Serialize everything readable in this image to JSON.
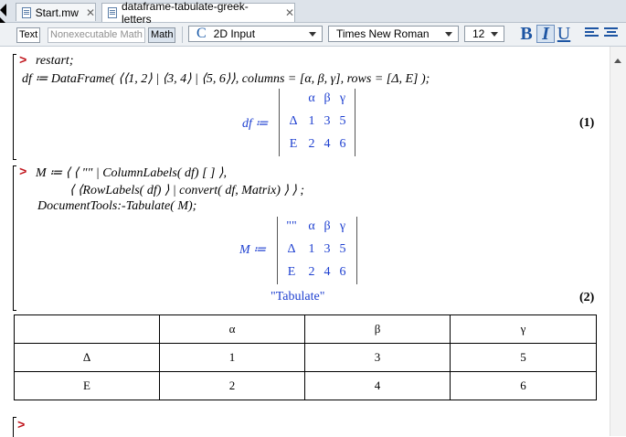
{
  "tabs": [
    {
      "label": "Start.mw",
      "close": "✕"
    },
    {
      "label": "dataframe-tabulate-greek-letters",
      "close": "✕"
    }
  ],
  "toolbar": {
    "mode_text": "Text",
    "mode_nonexec": "Nonexecutable Math",
    "mode_math": "Math",
    "input_mode": "2D Input",
    "font": "Times New Roman",
    "size": "12",
    "bold": "B",
    "italic": "I",
    "underline": "U"
  },
  "doc": {
    "prompt": ">",
    "group1": {
      "line1": "restart;",
      "line2_a": "df",
      "line2_b": " ≔ DataFrame( ⟨⟨1, 2⟩ | ⟨3, 4⟩ | ⟨5, 6⟩⟩, columns = [α, β, γ], rows = [Δ, Ε] );",
      "out_lhs": "df ≔",
      "matrix": {
        "header": [
          "",
          "α",
          "β",
          "γ"
        ],
        "rows": [
          [
            "Δ",
            "1",
            "3",
            "5"
          ],
          [
            "Ε",
            "2",
            "4",
            "6"
          ]
        ]
      },
      "label": "(1)"
    },
    "group2": {
      "line1": "M ≔ ⟨ ⟨ \"\" | ColumnLabels( df) [ ] ⟩,",
      "line2": "⟨ ⟨RowLabels( df) ⟩ | convert( df, Matrix) ⟩ ⟩ ;",
      "line3": "DocumentTools:-Tabulate( M);",
      "out_lhs": "M ≔",
      "matrix": {
        "rows": [
          [
            "\"\"",
            "α",
            "β",
            "γ"
          ],
          [
            "Δ",
            "1",
            "3",
            "5"
          ],
          [
            "Ε",
            "2",
            "4",
            "6"
          ]
        ]
      },
      "string_out": "\"Tabulate\"",
      "label": "(2)"
    },
    "table": {
      "header": [
        "",
        "α",
        "β",
        "γ"
      ],
      "rows": [
        [
          "Δ",
          "1",
          "3",
          "5"
        ],
        [
          "Ε",
          "2",
          "4",
          "6"
        ]
      ]
    }
  }
}
